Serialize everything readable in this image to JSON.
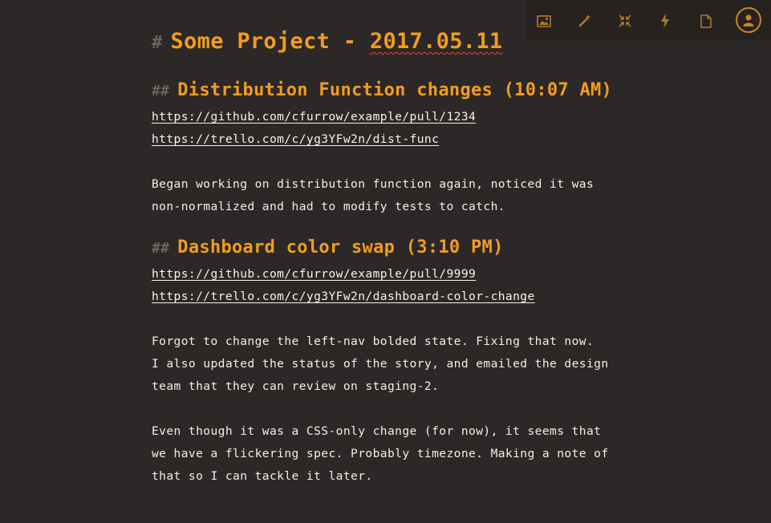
{
  "toolbar": {
    "icons": [
      "image-icon",
      "magic-wand-icon",
      "collapse-icon",
      "lightning-icon",
      "document-icon",
      "user-avatar-icon"
    ],
    "accent": "#c9862a"
  },
  "document": {
    "h1_marker": "#",
    "title_prefix": "Some Project - ",
    "title_date": "2017.05.11",
    "h2_marker": "##",
    "sections": [
      {
        "heading": "Distribution Function changes (10:07 AM)",
        "links": [
          "https://github.com/cfurrow/example/pull/1234",
          "https://trello.com/c/yg3YFw2n/dist-func"
        ],
        "paragraphs": [
          [
            "Began working on distribution function again, noticed it was",
            "non-normalized and had to modify tests to catch."
          ]
        ]
      },
      {
        "heading": "Dashboard color swap (3:10 PM)",
        "links": [
          "https://github.com/cfurrow/example/pull/9999",
          "https://trello.com/c/yg3YFw2n/dashboard-color-change"
        ],
        "paragraphs": [
          [
            "Forgot to change the left-nav bolded state. Fixing that now.",
            "I also updated the status of the story, and emailed the design",
            "team that they can review on staging-2."
          ],
          [
            "Even though it was a CSS-only change (for now), it seems that",
            "we have a flickering spec. Probably timezone. Making a note of",
            "that so I can tackle it later."
          ]
        ]
      }
    ]
  },
  "colors": {
    "background": "#2b2827",
    "heading": "#f39c1f",
    "text": "#f3efe6",
    "marker": "#6b6560",
    "spellcheck": "#e0463a"
  }
}
